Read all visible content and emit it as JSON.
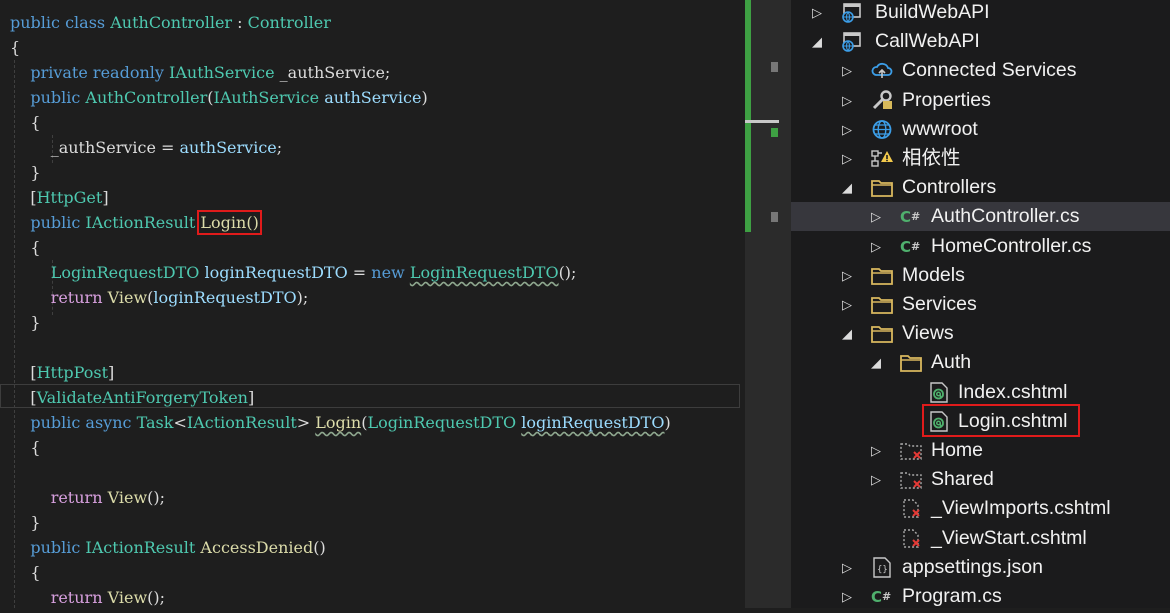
{
  "editor": {
    "lines": [
      [
        [
          "public",
          "kw"
        ],
        [
          " ",
          "tx"
        ],
        [
          "class",
          "kw"
        ],
        [
          " ",
          "tx"
        ],
        [
          "AuthController",
          "ty"
        ],
        [
          " : ",
          "tx"
        ],
        [
          "Controller",
          "ty"
        ]
      ],
      [
        [
          "{",
          "tx"
        ]
      ],
      [
        [
          "    ",
          "tx"
        ],
        [
          "private",
          "kw"
        ],
        [
          " ",
          "tx"
        ],
        [
          "readonly",
          "kw"
        ],
        [
          " ",
          "tx"
        ],
        [
          "IAuthService",
          "ty"
        ],
        [
          " _authService;",
          "tx"
        ]
      ],
      [
        [
          "    ",
          "tx"
        ],
        [
          "public",
          "kw"
        ],
        [
          " ",
          "tx"
        ],
        [
          "AuthController",
          "ty"
        ],
        [
          "(",
          "tx"
        ],
        [
          "IAuthService",
          "ty"
        ],
        [
          " ",
          "tx"
        ],
        [
          "authService",
          "pa"
        ],
        [
          ")",
          "tx"
        ]
      ],
      [
        [
          "    {",
          "tx"
        ]
      ],
      [
        [
          "        _authService = ",
          "tx"
        ],
        [
          "authService",
          "pa"
        ],
        [
          ";",
          "tx"
        ]
      ],
      [
        [
          "    }",
          "tx"
        ]
      ],
      [
        [
          "    [",
          "tx"
        ],
        [
          "HttpGet",
          "ty"
        ],
        [
          "]",
          "tx"
        ]
      ],
      [
        [
          "    ",
          "tx"
        ],
        [
          "public",
          "kw"
        ],
        [
          " ",
          "tx"
        ],
        [
          "IActionResult",
          "ty"
        ],
        [
          " ",
          "tx"
        ],
        [
          "Login()",
          "mhl"
        ]
      ],
      [
        [
          "    {",
          "tx"
        ]
      ],
      [
        [
          "        ",
          "tx"
        ],
        [
          "LoginRequestDTO",
          "ty"
        ],
        [
          " ",
          "tx"
        ],
        [
          "loginRequestDTO",
          "pa"
        ],
        [
          " = ",
          "tx"
        ],
        [
          "new",
          "kw"
        ],
        [
          " ",
          "tx"
        ],
        [
          "LoginRequestDTO",
          "tysq"
        ],
        [
          "();",
          "tx"
        ]
      ],
      [
        [
          "        ",
          "tx"
        ],
        [
          "return",
          "kc"
        ],
        [
          " ",
          "tx"
        ],
        [
          "View",
          "me"
        ],
        [
          "(",
          "tx"
        ],
        [
          "loginRequestDTO",
          "pa"
        ],
        [
          ");",
          "tx"
        ]
      ],
      [
        [
          "    }",
          "tx"
        ]
      ],
      [
        [
          "",
          "tx"
        ]
      ],
      [
        [
          "    [",
          "tx"
        ],
        [
          "HttpPost",
          "ty"
        ],
        [
          "]",
          "tx"
        ]
      ],
      [
        [
          "    [",
          "tx"
        ],
        [
          "ValidateAntiForgeryToken",
          "ty"
        ],
        [
          "]",
          "tx"
        ]
      ],
      [
        [
          "    ",
          "tx"
        ],
        [
          "public",
          "kw"
        ],
        [
          " ",
          "tx"
        ],
        [
          "async",
          "kw"
        ],
        [
          " ",
          "tx"
        ],
        [
          "Task",
          "ty"
        ],
        [
          "<",
          "tx"
        ],
        [
          "IActionResult",
          "ty"
        ],
        [
          "> ",
          "tx"
        ],
        [
          "Login",
          "mesq"
        ],
        [
          "(",
          "tx"
        ],
        [
          "LoginRequestDTO",
          "ty"
        ],
        [
          " ",
          "tx"
        ],
        [
          "loginRequestDTO",
          "pasq"
        ],
        [
          ")",
          "tx"
        ]
      ],
      [
        [
          "    {",
          "tx"
        ]
      ],
      [
        [
          "",
          "tx"
        ]
      ],
      [
        [
          "        ",
          "tx"
        ],
        [
          "return",
          "kc"
        ],
        [
          " ",
          "tx"
        ],
        [
          "View",
          "me"
        ],
        [
          "();",
          "tx"
        ]
      ],
      [
        [
          "    }",
          "tx"
        ]
      ],
      [
        [
          "    ",
          "tx"
        ],
        [
          "public",
          "kw"
        ],
        [
          " ",
          "tx"
        ],
        [
          "IActionResult",
          "ty"
        ],
        [
          " ",
          "tx"
        ],
        [
          "AccessDenied",
          "me"
        ],
        [
          "()",
          "tx"
        ]
      ],
      [
        [
          "    {",
          "tx"
        ]
      ],
      [
        [
          "        ",
          "tx"
        ],
        [
          "return",
          "kc"
        ],
        [
          " ",
          "tx"
        ],
        [
          "View",
          "me"
        ],
        [
          "();",
          "tx"
        ]
      ]
    ],
    "colors": {
      "kw": "#569cd6",
      "kc": "#d8a0df",
      "ty": "#4ec9b0",
      "pa": "#9cdcfe",
      "me": "#dcdcaa",
      "tx": "#dcdcdc"
    }
  },
  "solution_explorer": {
    "items": [
      {
        "label": "BuildWebAPI",
        "indent": 0,
        "arrow": "right",
        "icon": "project-icon",
        "selected": false,
        "highlighted": false
      },
      {
        "label": "CallWebAPI",
        "indent": 0,
        "arrow": "down",
        "icon": "project-icon",
        "selected": false,
        "highlighted": false
      },
      {
        "label": "Connected Services",
        "indent": 1,
        "arrow": "right",
        "icon": "connected-services-icon",
        "selected": false,
        "highlighted": false
      },
      {
        "label": "Properties",
        "indent": 1,
        "arrow": "right",
        "icon": "wrench-icon",
        "selected": false,
        "highlighted": false
      },
      {
        "label": "wwwroot",
        "indent": 1,
        "arrow": "right",
        "icon": "globe-icon",
        "selected": false,
        "highlighted": false
      },
      {
        "label": "相依性",
        "indent": 1,
        "arrow": "right",
        "icon": "dependencies-warning-icon",
        "selected": false,
        "highlighted": false
      },
      {
        "label": "Controllers",
        "indent": 1,
        "arrow": "down",
        "icon": "folder-icon",
        "selected": false,
        "highlighted": false
      },
      {
        "label": "AuthController.cs",
        "indent": 2,
        "arrow": "right",
        "icon": "csharp-file-icon",
        "selected": true,
        "highlighted": false
      },
      {
        "label": "HomeController.cs",
        "indent": 2,
        "arrow": "right",
        "icon": "csharp-file-icon",
        "selected": false,
        "highlighted": false
      },
      {
        "label": "Models",
        "indent": 1,
        "arrow": "right",
        "icon": "folder-icon",
        "selected": false,
        "highlighted": false
      },
      {
        "label": "Services",
        "indent": 1,
        "arrow": "right",
        "icon": "folder-icon",
        "selected": false,
        "highlighted": false
      },
      {
        "label": "Views",
        "indent": 1,
        "arrow": "down",
        "icon": "folder-icon",
        "selected": false,
        "highlighted": false
      },
      {
        "label": "Auth",
        "indent": 2,
        "arrow": "down",
        "icon": "folder-icon",
        "selected": false,
        "highlighted": false
      },
      {
        "label": "Index.cshtml",
        "indent": 3,
        "arrow": "none",
        "icon": "razor-file-icon",
        "selected": false,
        "highlighted": false
      },
      {
        "label": "Login.cshtml",
        "indent": 3,
        "arrow": "none",
        "icon": "razor-file-icon",
        "selected": false,
        "highlighted": true
      },
      {
        "label": "Home",
        "indent": 2,
        "arrow": "right",
        "icon": "excluded-folder-icon",
        "selected": false,
        "highlighted": false
      },
      {
        "label": "Shared",
        "indent": 2,
        "arrow": "right",
        "icon": "excluded-folder-icon",
        "selected": false,
        "highlighted": false
      },
      {
        "label": "_ViewImports.cshtml",
        "indent": 2,
        "arrow": "none",
        "icon": "excluded-file-icon",
        "selected": false,
        "highlighted": false
      },
      {
        "label": "_ViewStart.cshtml",
        "indent": 2,
        "arrow": "none",
        "icon": "excluded-file-icon",
        "selected": false,
        "highlighted": false
      },
      {
        "label": "appsettings.json",
        "indent": 1,
        "arrow": "right",
        "icon": "json-file-icon",
        "selected": false,
        "highlighted": false
      },
      {
        "label": "Program.cs",
        "indent": 1,
        "arrow": "right",
        "icon": "csharp-file-icon",
        "selected": false,
        "highlighted": false
      }
    ]
  }
}
